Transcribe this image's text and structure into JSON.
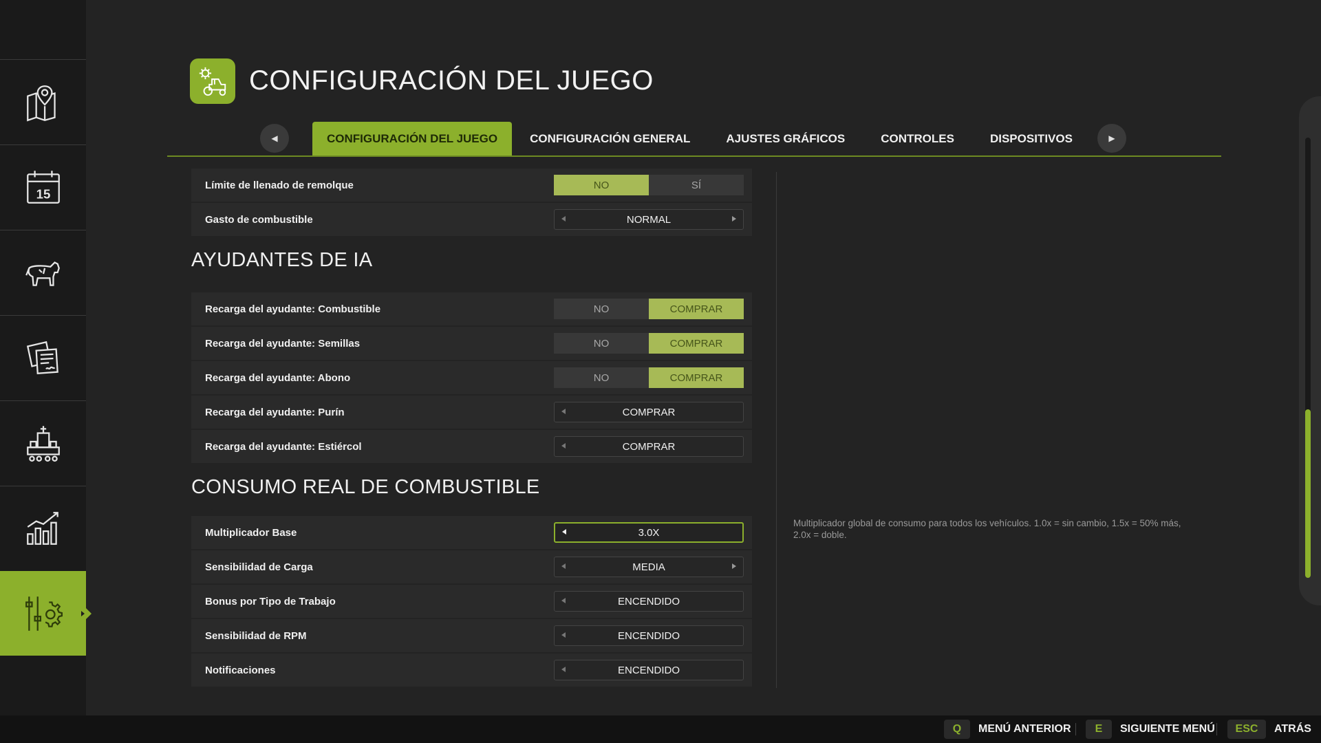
{
  "page": {
    "title": "CONFIGURACIÓN DEL JUEGO"
  },
  "sidebar": {
    "items": [
      {
        "name": "map",
        "icon": "map-pin-icon"
      },
      {
        "name": "calendar",
        "icon": "calendar-icon",
        "label": "15"
      },
      {
        "name": "animals",
        "icon": "cow-icon"
      },
      {
        "name": "contracts",
        "icon": "documents-icon"
      },
      {
        "name": "production",
        "icon": "factory-icon"
      },
      {
        "name": "statistics",
        "icon": "bar-chart-icon"
      },
      {
        "name": "settings",
        "icon": "settings-sliders-icon",
        "active": true
      }
    ]
  },
  "tabs": [
    {
      "label": "CONFIGURACIÓN DEL JUEGO",
      "active": true
    },
    {
      "label": "CONFIGURACIÓN GENERAL"
    },
    {
      "label": "AJUSTES GRÁFICOS"
    },
    {
      "label": "CONTROLES"
    },
    {
      "label": "DISPOSITIVOS"
    }
  ],
  "settings": {
    "top_rows": [
      {
        "label": "Límite de llenado de remolque",
        "type": "toggle",
        "options": [
          "NO",
          "SÍ"
        ],
        "selected": 0
      },
      {
        "label": "Gasto de combustible",
        "type": "selector",
        "value": "NORMAL"
      }
    ],
    "ai_helpers": {
      "title": "AYUDANTES DE IA",
      "rows": [
        {
          "label": "Recarga del ayudante: Combustible",
          "type": "toggle",
          "options": [
            "NO",
            "COMPRAR"
          ],
          "selected": 1
        },
        {
          "label": "Recarga del ayudante: Semillas",
          "type": "toggle",
          "options": [
            "NO",
            "COMPRAR"
          ],
          "selected": 1
        },
        {
          "label": "Recarga del ayudante: Abono",
          "type": "toggle",
          "options": [
            "NO",
            "COMPRAR"
          ],
          "selected": 1
        },
        {
          "label": "Recarga del ayudante: Purín",
          "type": "selector",
          "value": "COMPRAR"
        },
        {
          "label": "Recarga del ayudante: Estiércol",
          "type": "selector",
          "value": "COMPRAR"
        }
      ]
    },
    "fuel": {
      "title": "CONSUMO REAL DE COMBUSTIBLE",
      "rows": [
        {
          "label": "Multiplicador Base",
          "type": "selector",
          "value": "3.0X",
          "focused": true
        },
        {
          "label": "Sensibilidad de Carga",
          "type": "selector",
          "value": "MEDIA"
        },
        {
          "label": "Bonus por Tipo de Trabajo",
          "type": "selector",
          "value": "ENCENDIDO"
        },
        {
          "label": "Sensibilidad de RPM",
          "type": "selector",
          "value": "ENCENDIDO"
        },
        {
          "label": "Notificaciones",
          "type": "selector",
          "value": "ENCENDIDO"
        }
      ]
    }
  },
  "description": "Multiplicador global de consumo para todos los vehículos. 1.0x = sin cambio, 1.5x = 50% más, 2.0x = doble.",
  "footer": {
    "hints": [
      {
        "key": "Q",
        "label": "MENÚ ANTERIOR"
      },
      {
        "key": "E",
        "label": "SIGUIENTE MENÚ"
      },
      {
        "key": "ESC",
        "label": "ATRÁS"
      }
    ]
  },
  "colors": {
    "accent": "#8cb02c",
    "toggle_selected": "#a7ba56",
    "background": "#232323",
    "sidebar": "#1a1a1a"
  }
}
